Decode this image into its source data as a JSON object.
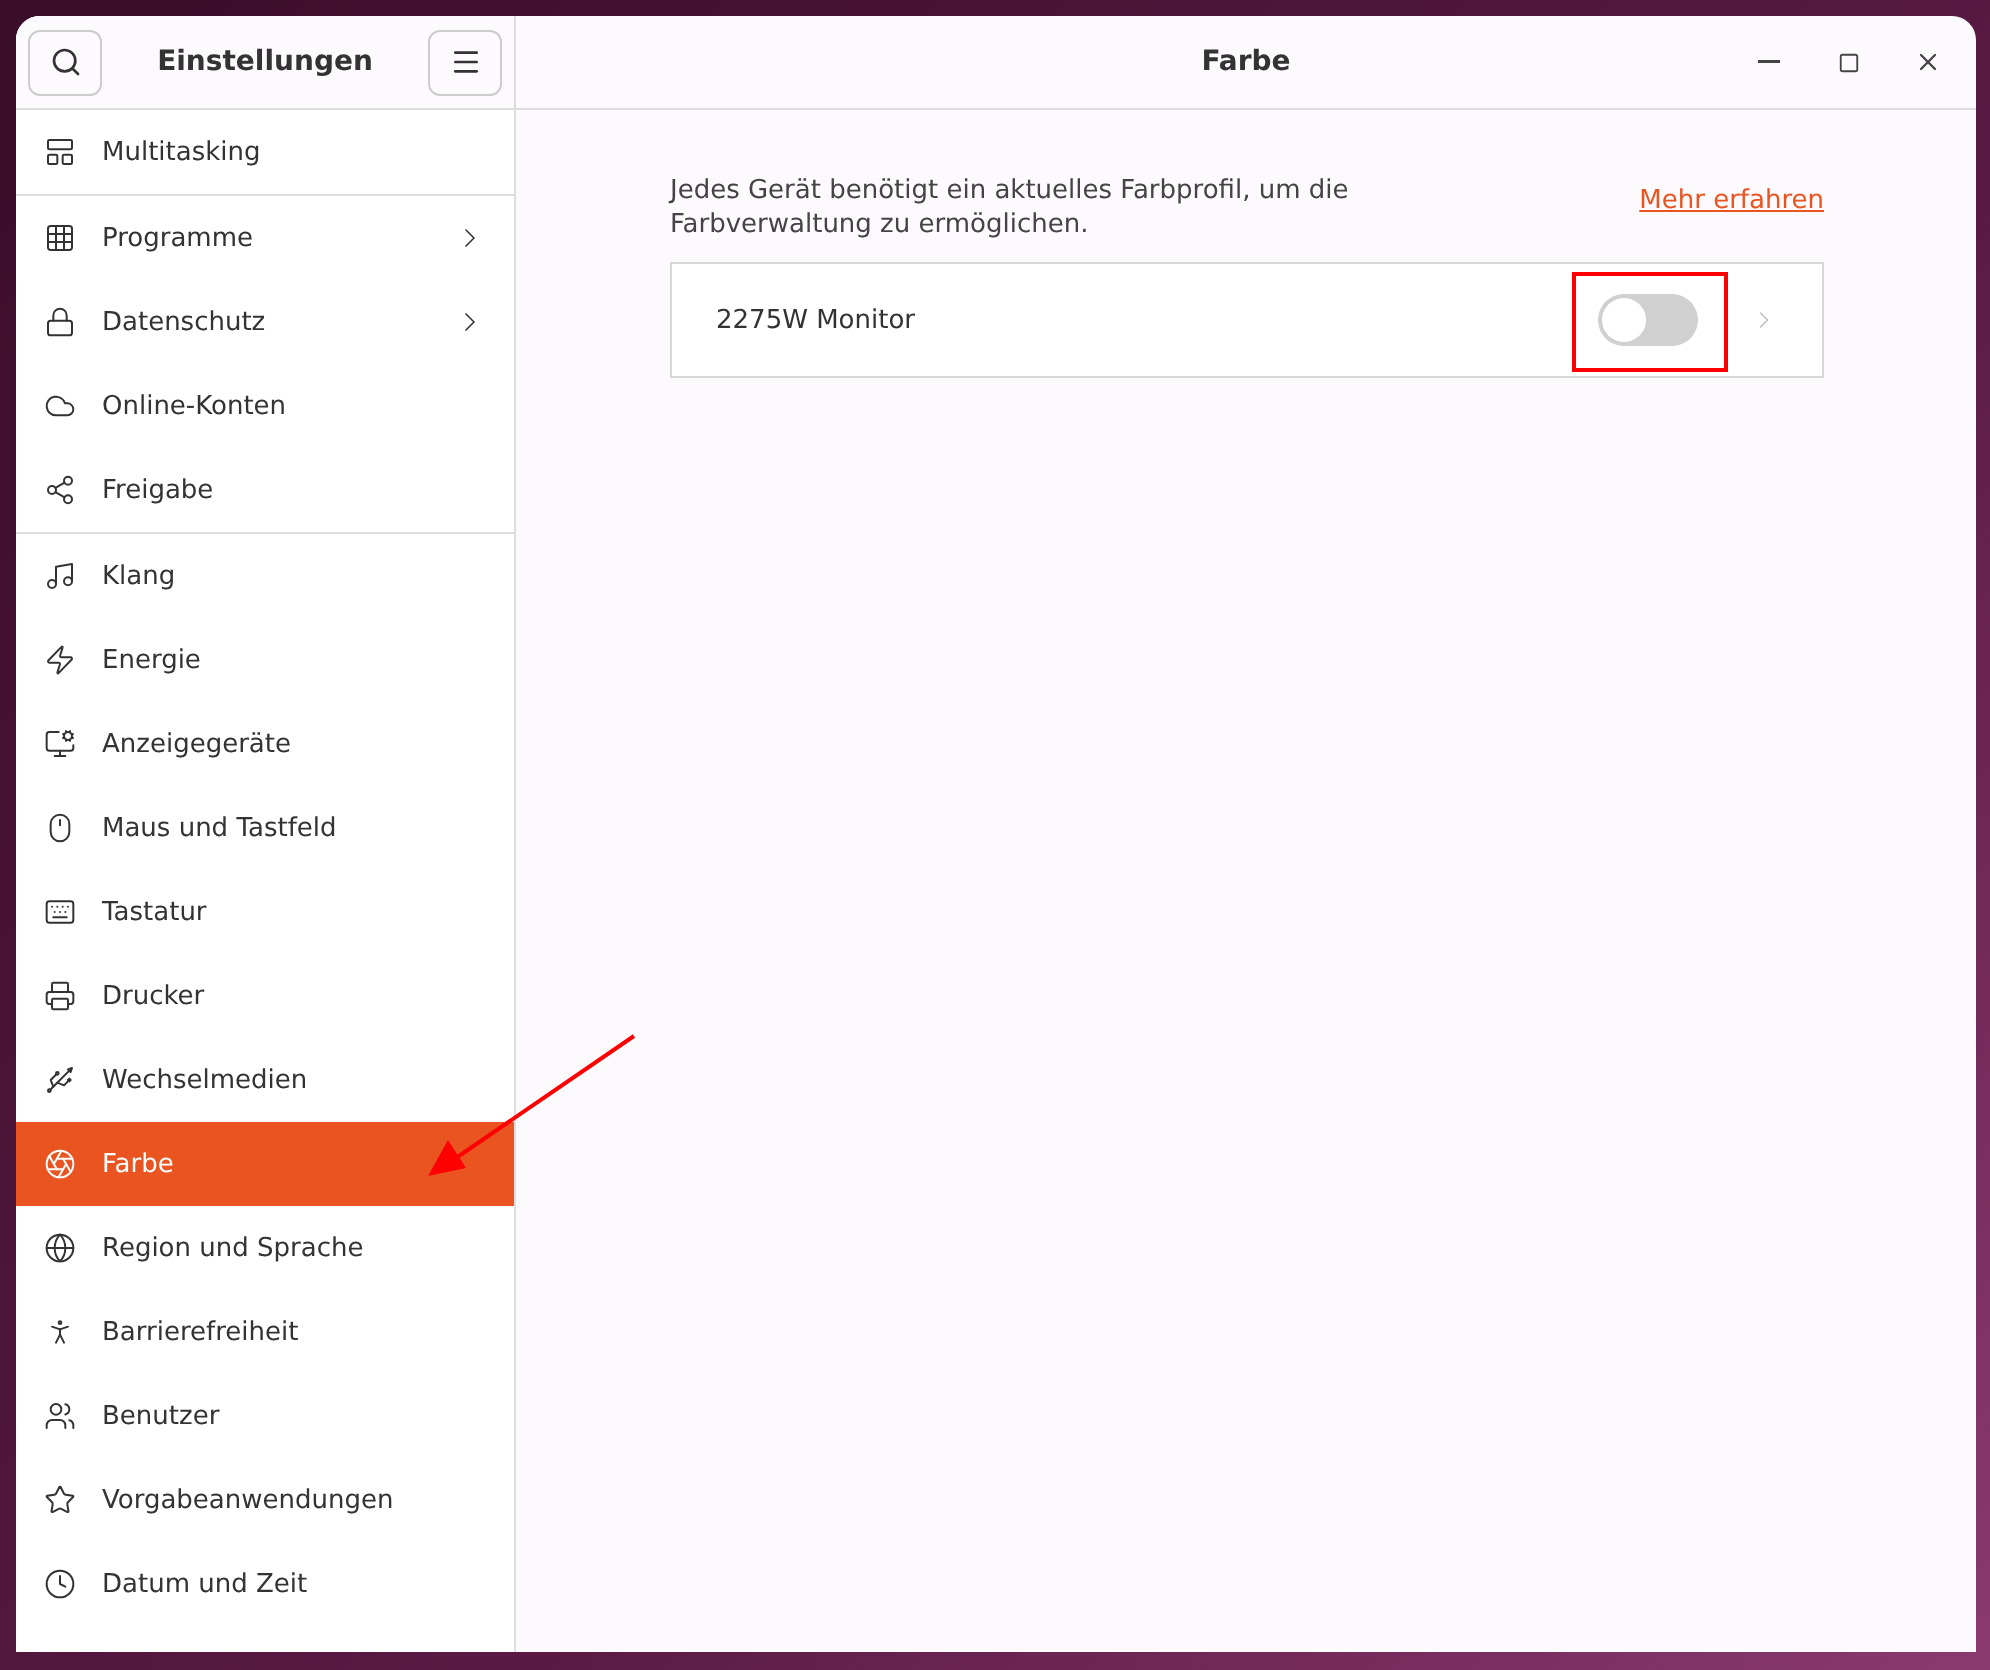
{
  "sidebar": {
    "title": "Einstellungen",
    "groups": [
      {
        "items": [
          {
            "label": "Multitasking",
            "selected": false,
            "submenu": false
          }
        ]
      },
      {
        "items": [
          {
            "label": "Programme",
            "selected": false,
            "submenu": true
          },
          {
            "label": "Datenschutz",
            "selected": false,
            "submenu": true
          },
          {
            "label": "Online-Konten",
            "selected": false,
            "submenu": false
          },
          {
            "label": "Freigabe",
            "selected": false,
            "submenu": false
          }
        ]
      },
      {
        "items": [
          {
            "label": "Klang",
            "selected": false,
            "submenu": false
          },
          {
            "label": "Energie",
            "selected": false,
            "submenu": false
          },
          {
            "label": "Anzeigegeräte",
            "selected": false,
            "submenu": false
          },
          {
            "label": "Maus und Tastfeld",
            "selected": false,
            "submenu": false
          },
          {
            "label": "Tastatur",
            "selected": false,
            "submenu": false
          },
          {
            "label": "Drucker",
            "selected": false,
            "submenu": false
          },
          {
            "label": "Wechselmedien",
            "selected": false,
            "submenu": false
          },
          {
            "label": "Farbe",
            "selected": true,
            "submenu": false
          },
          {
            "label": "Region und Sprache",
            "selected": false,
            "submenu": false
          },
          {
            "label": "Barrierefreiheit",
            "selected": false,
            "submenu": false
          },
          {
            "label": "Benutzer",
            "selected": false,
            "submenu": false
          },
          {
            "label": "Vorgabeanwendungen",
            "selected": false,
            "submenu": false
          },
          {
            "label": "Datum und Zeit",
            "selected": false,
            "submenu": false
          }
        ]
      }
    ]
  },
  "window": {
    "title": "Farbe"
  },
  "content": {
    "description": "Jedes Gerät benötigt ein aktuelles Farbprofil, um die Farbverwaltung zu ermöglichen.",
    "link": "Mehr erfahren",
    "devices": [
      {
        "name": "2275W Monitor",
        "on": false
      }
    ]
  }
}
